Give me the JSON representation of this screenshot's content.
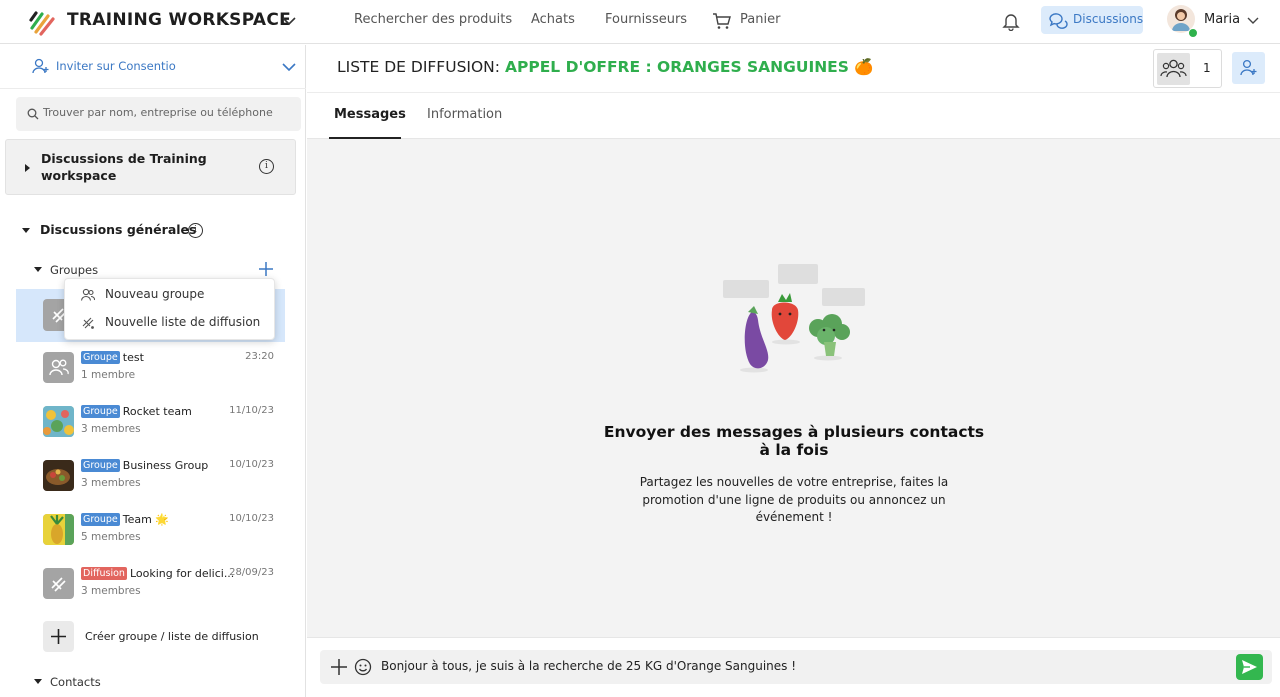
{
  "topbar": {
    "workspace_title": "TRAINING WORKSPACE",
    "nav": [
      "Rechercher des produits",
      "Achats",
      "Fournisseurs",
      "Panier"
    ],
    "discussions_label": "Discussions",
    "user_name": "Maria"
  },
  "sidebar": {
    "invite_label": "Inviter sur Consentio",
    "search_placeholder": "Trouver par nom, entreprise ou téléphone",
    "workspace_discussions": "Discussions de Training workspace",
    "general_discussions": "Discussions générales",
    "groups_label": "Groupes",
    "dropdown": [
      "Nouveau groupe",
      "Nouvelle liste de diffusion"
    ],
    "items": [
      {
        "badge": "Groupe",
        "name": "test",
        "sub": "1 membre",
        "time": "23:20"
      },
      {
        "badge": "Groupe",
        "name": "Rocket team",
        "sub": "3 membres",
        "time": "11/10/23"
      },
      {
        "badge": "Groupe",
        "name": "Business Group",
        "sub": "3 membres",
        "time": "10/10/23"
      },
      {
        "badge": "Groupe",
        "name": "Team 🌟",
        "sub": "5 membres",
        "time": "10/10/23"
      },
      {
        "badge": "Diffusion",
        "name": "Looking for delici...",
        "sub": "3 membres",
        "time": "28/09/23"
      }
    ],
    "create_label": "Créer groupe / liste de diffusion",
    "contacts_label": "Contacts"
  },
  "header": {
    "list_prefix": "LISTE DE DIFFUSION:",
    "list_name": "APPEL D'OFFRE : ORANGES SANGUINES 🍊",
    "members_count": "1"
  },
  "tabs": [
    "Messages",
    "Information"
  ],
  "empty_state": {
    "title": "Envoyer des messages à plusieurs contacts à la fois",
    "text": "Partagez les nouvelles de votre entreprise, faites la promotion d'une ligne de produits ou annoncez un événement !"
  },
  "composer": {
    "value": "Bonjour à tous, je suis à la recherche de 25 KG d'Orange Sanguines !"
  },
  "colors": {
    "accent_blue": "#3b78c4",
    "green": "#2fae4d",
    "selected_bg": "#d6e7fb",
    "badge_group": "#4a8ad4",
    "badge_diffusion": "#e2655e"
  }
}
